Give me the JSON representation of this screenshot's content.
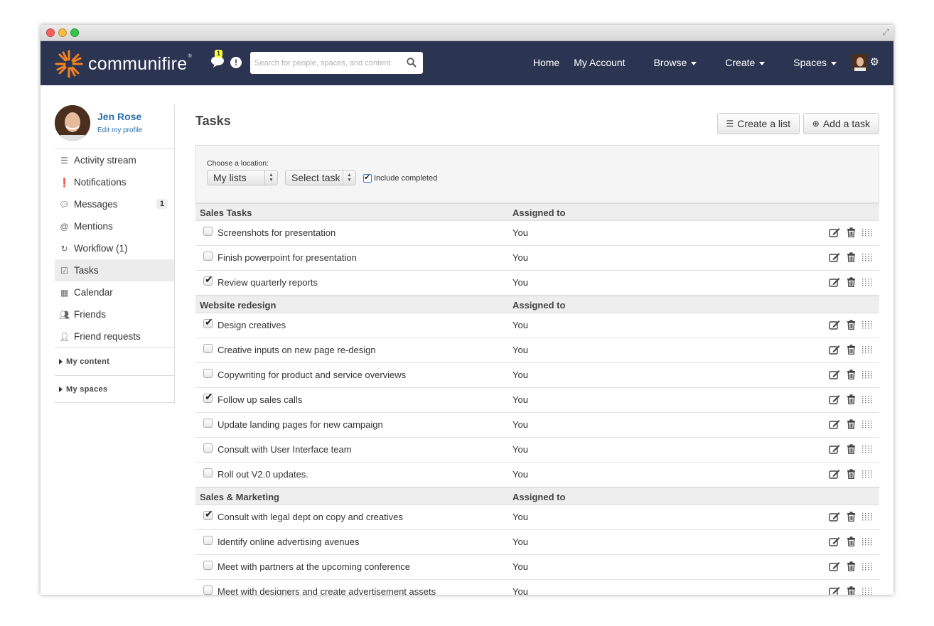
{
  "navbar": {
    "brand": "communifire",
    "brand_mark": "®",
    "messages_badge": "1",
    "search_placeholder": "Search for people, spaces, and content",
    "links": {
      "home": "Home",
      "my_account": "My Account",
      "browse": "Browse",
      "create": "Create",
      "spaces": "Spaces"
    }
  },
  "profile": {
    "name": "Jen Rose",
    "edit_label": "Edit my profile"
  },
  "sidebar": {
    "items": [
      {
        "label": "Activity stream",
        "icon": "list-icon"
      },
      {
        "label": "Notifications",
        "icon": "alert-icon"
      },
      {
        "label": "Messages",
        "icon": "speech-bubble-icon",
        "badge": "1"
      },
      {
        "label": "Mentions",
        "icon": "at-icon"
      },
      {
        "label": "Workflow (1)",
        "icon": "refresh-icon"
      },
      {
        "label": "Tasks",
        "icon": "checkbox-icon"
      },
      {
        "label": "Calendar",
        "icon": "calendar-icon"
      },
      {
        "label": "Friends",
        "icon": "group-icon"
      },
      {
        "label": "Friend requests",
        "icon": "user-icon"
      }
    ],
    "sections": {
      "my_content": "My content",
      "my_spaces": "My spaces"
    }
  },
  "main": {
    "title": "Tasks",
    "create_list_label": "Create a list",
    "add_task_label": "Add a task",
    "filter": {
      "choose_label": "Choose a location:",
      "location_value": "My lists",
      "task_value": "Select task",
      "include_completed_label": "Include completed"
    }
  },
  "assigned_header": "Assigned to",
  "groups": [
    {
      "name": "Sales Tasks",
      "tasks": [
        {
          "name": "Screenshots for presentation",
          "assigned": "You",
          "done": false
        },
        {
          "name": "Finish powerpoint for presentation",
          "assigned": "You",
          "done": false
        },
        {
          "name": "Review quarterly reports",
          "assigned": "You",
          "done": true
        }
      ]
    },
    {
      "name": "Website redesign",
      "tasks": [
        {
          "name": "Design creatives",
          "assigned": "You",
          "done": true
        },
        {
          "name": "Creative inputs on new page re-design",
          "assigned": "You",
          "done": false
        },
        {
          "name": "Copywriting for product and service overviews",
          "assigned": "You",
          "done": false
        },
        {
          "name": "Follow up sales calls",
          "assigned": "You",
          "done": true
        },
        {
          "name": "Update landing pages for new campaign",
          "assigned": "You",
          "done": false
        },
        {
          "name": "Consult with User Interface team",
          "assigned": "You",
          "done": false
        },
        {
          "name": "Roll out V2.0 updates.",
          "assigned": "You",
          "done": false
        }
      ]
    },
    {
      "name": "Sales & Marketing",
      "tasks": [
        {
          "name": "Consult with legal dept on copy and creatives",
          "assigned": "You",
          "done": true
        },
        {
          "name": "Identify online advertising avenues",
          "assigned": "You",
          "done": false
        },
        {
          "name": "Meet with partners at the upcoming conference",
          "assigned": "You",
          "done": false
        },
        {
          "name": "Meet with designers and create advertisement assets",
          "assigned": "You",
          "done": false
        }
      ]
    }
  ],
  "colors": {
    "navbar_bg": "#2b3451",
    "brand_orange": "#f5821f",
    "link_blue": "#2b6ea8",
    "badge_yellow": "#ffff33"
  }
}
